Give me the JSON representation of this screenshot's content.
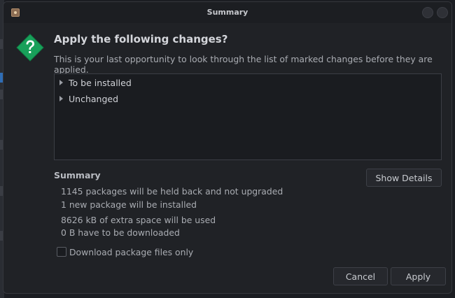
{
  "window": {
    "title": "Summary"
  },
  "header": {
    "heading": "Apply the following changes?",
    "subtext": "This is your last opportunity to look through the list of marked changes before they are applied."
  },
  "changes_tree": {
    "items": [
      {
        "label": "To be installed"
      },
      {
        "label": "Unchanged"
      }
    ]
  },
  "summary": {
    "title": "Summary",
    "show_details_label": "Show Details",
    "lines": [
      "1145 packages will be held back and not upgraded",
      "1 new package will be installed",
      "8626 kB of extra space will be used",
      "0  B have to be downloaded"
    ]
  },
  "download_only": {
    "label": "Download package files only",
    "checked": false
  },
  "actions": {
    "cancel_label": "Cancel",
    "apply_label": "Apply"
  },
  "colors": {
    "icon_green": "#18a05a",
    "background": "#202226"
  }
}
